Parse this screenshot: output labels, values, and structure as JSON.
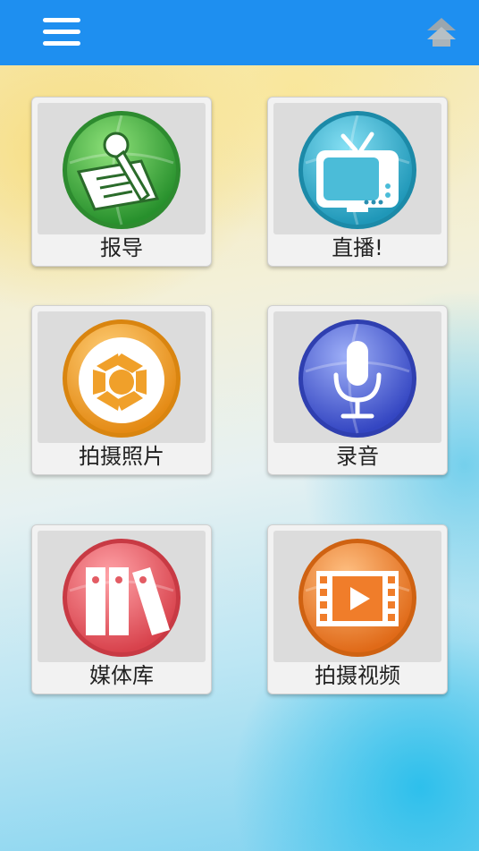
{
  "header": {
    "menu_icon": "hamburger-menu-icon",
    "top_icon": "double-chevron-up-icon",
    "color": "#1e8ff0"
  },
  "tiles": [
    {
      "label": "报导",
      "icon": "microphone-paper-icon",
      "color": "#3aa83c"
    },
    {
      "label": "直播!",
      "icon": "tv-icon",
      "color": "#2aa7c6"
    },
    {
      "label": "拍摄照片",
      "icon": "camera-shutter-icon",
      "color": "#f0a02a"
    },
    {
      "label": "录音",
      "icon": "microphone-icon",
      "color": "#4a63d6"
    },
    {
      "label": "媒体库",
      "icon": "binders-icon",
      "color": "#e35c64"
    },
    {
      "label": "拍摄视频",
      "icon": "video-film-icon",
      "color": "#f07d2a"
    }
  ]
}
